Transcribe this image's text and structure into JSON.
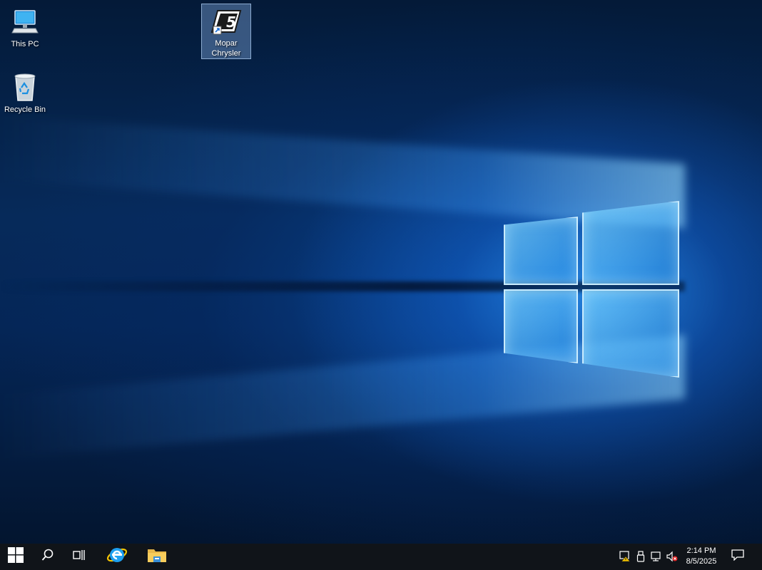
{
  "desktop": {
    "icons": [
      {
        "label": "This PC",
        "icon": "computer-icon"
      },
      {
        "label": "Recycle Bin",
        "icon": "recycle-bin-icon"
      },
      {
        "label": "Mopar\nChrysler",
        "icon": "mopar-chrysler-shortcut-icon",
        "selected": true
      }
    ]
  },
  "taskbar": {
    "start_icon": "windows-logo-icon",
    "search_icon": "search-icon",
    "task_view_icon": "task-view-icon",
    "pinned": [
      {
        "name": "Internet Explorer",
        "icon": "internet-explorer-icon"
      },
      {
        "name": "File Explorer",
        "icon": "file-explorer-icon"
      }
    ],
    "tray": {
      "icons": [
        "action-center-warning-icon",
        "usb-device-icon",
        "network-icon",
        "volume-muted-icon"
      ],
      "time": "2:14 PM",
      "date": "8/5/2025",
      "notification_icon": "notification-icon"
    }
  },
  "colors": {
    "taskbar": "#101419",
    "wallpaper_dark": "#041a38",
    "wallpaper_glow": "#288ceb"
  }
}
